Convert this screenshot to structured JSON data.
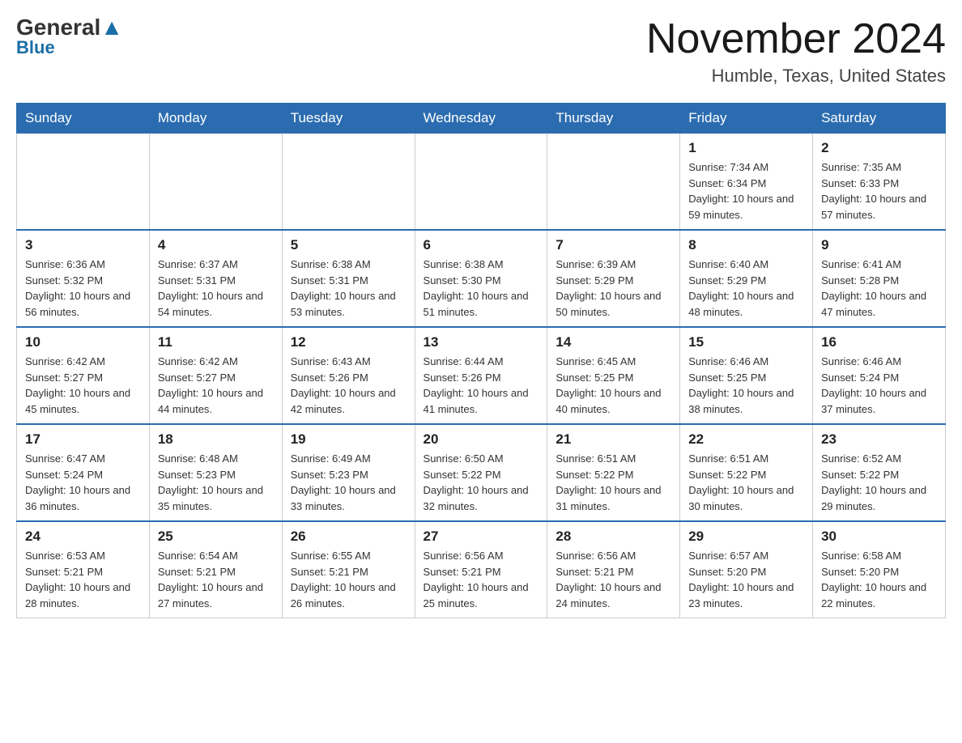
{
  "header": {
    "logo_general": "General",
    "logo_blue": "Blue",
    "month_title": "November 2024",
    "location": "Humble, Texas, United States"
  },
  "weekdays": [
    "Sunday",
    "Monday",
    "Tuesday",
    "Wednesday",
    "Thursday",
    "Friday",
    "Saturday"
  ],
  "weeks": [
    [
      {
        "day": "",
        "info": ""
      },
      {
        "day": "",
        "info": ""
      },
      {
        "day": "",
        "info": ""
      },
      {
        "day": "",
        "info": ""
      },
      {
        "day": "",
        "info": ""
      },
      {
        "day": "1",
        "info": "Sunrise: 7:34 AM\nSunset: 6:34 PM\nDaylight: 10 hours and 59 minutes."
      },
      {
        "day": "2",
        "info": "Sunrise: 7:35 AM\nSunset: 6:33 PM\nDaylight: 10 hours and 57 minutes."
      }
    ],
    [
      {
        "day": "3",
        "info": "Sunrise: 6:36 AM\nSunset: 5:32 PM\nDaylight: 10 hours and 56 minutes."
      },
      {
        "day": "4",
        "info": "Sunrise: 6:37 AM\nSunset: 5:31 PM\nDaylight: 10 hours and 54 minutes."
      },
      {
        "day": "5",
        "info": "Sunrise: 6:38 AM\nSunset: 5:31 PM\nDaylight: 10 hours and 53 minutes."
      },
      {
        "day": "6",
        "info": "Sunrise: 6:38 AM\nSunset: 5:30 PM\nDaylight: 10 hours and 51 minutes."
      },
      {
        "day": "7",
        "info": "Sunrise: 6:39 AM\nSunset: 5:29 PM\nDaylight: 10 hours and 50 minutes."
      },
      {
        "day": "8",
        "info": "Sunrise: 6:40 AM\nSunset: 5:29 PM\nDaylight: 10 hours and 48 minutes."
      },
      {
        "day": "9",
        "info": "Sunrise: 6:41 AM\nSunset: 5:28 PM\nDaylight: 10 hours and 47 minutes."
      }
    ],
    [
      {
        "day": "10",
        "info": "Sunrise: 6:42 AM\nSunset: 5:27 PM\nDaylight: 10 hours and 45 minutes."
      },
      {
        "day": "11",
        "info": "Sunrise: 6:42 AM\nSunset: 5:27 PM\nDaylight: 10 hours and 44 minutes."
      },
      {
        "day": "12",
        "info": "Sunrise: 6:43 AM\nSunset: 5:26 PM\nDaylight: 10 hours and 42 minutes."
      },
      {
        "day": "13",
        "info": "Sunrise: 6:44 AM\nSunset: 5:26 PM\nDaylight: 10 hours and 41 minutes."
      },
      {
        "day": "14",
        "info": "Sunrise: 6:45 AM\nSunset: 5:25 PM\nDaylight: 10 hours and 40 minutes."
      },
      {
        "day": "15",
        "info": "Sunrise: 6:46 AM\nSunset: 5:25 PM\nDaylight: 10 hours and 38 minutes."
      },
      {
        "day": "16",
        "info": "Sunrise: 6:46 AM\nSunset: 5:24 PM\nDaylight: 10 hours and 37 minutes."
      }
    ],
    [
      {
        "day": "17",
        "info": "Sunrise: 6:47 AM\nSunset: 5:24 PM\nDaylight: 10 hours and 36 minutes."
      },
      {
        "day": "18",
        "info": "Sunrise: 6:48 AM\nSunset: 5:23 PM\nDaylight: 10 hours and 35 minutes."
      },
      {
        "day": "19",
        "info": "Sunrise: 6:49 AM\nSunset: 5:23 PM\nDaylight: 10 hours and 33 minutes."
      },
      {
        "day": "20",
        "info": "Sunrise: 6:50 AM\nSunset: 5:22 PM\nDaylight: 10 hours and 32 minutes."
      },
      {
        "day": "21",
        "info": "Sunrise: 6:51 AM\nSunset: 5:22 PM\nDaylight: 10 hours and 31 minutes."
      },
      {
        "day": "22",
        "info": "Sunrise: 6:51 AM\nSunset: 5:22 PM\nDaylight: 10 hours and 30 minutes."
      },
      {
        "day": "23",
        "info": "Sunrise: 6:52 AM\nSunset: 5:22 PM\nDaylight: 10 hours and 29 minutes."
      }
    ],
    [
      {
        "day": "24",
        "info": "Sunrise: 6:53 AM\nSunset: 5:21 PM\nDaylight: 10 hours and 28 minutes."
      },
      {
        "day": "25",
        "info": "Sunrise: 6:54 AM\nSunset: 5:21 PM\nDaylight: 10 hours and 27 minutes."
      },
      {
        "day": "26",
        "info": "Sunrise: 6:55 AM\nSunset: 5:21 PM\nDaylight: 10 hours and 26 minutes."
      },
      {
        "day": "27",
        "info": "Sunrise: 6:56 AM\nSunset: 5:21 PM\nDaylight: 10 hours and 25 minutes."
      },
      {
        "day": "28",
        "info": "Sunrise: 6:56 AM\nSunset: 5:21 PM\nDaylight: 10 hours and 24 minutes."
      },
      {
        "day": "29",
        "info": "Sunrise: 6:57 AM\nSunset: 5:20 PM\nDaylight: 10 hours and 23 minutes."
      },
      {
        "day": "30",
        "info": "Sunrise: 6:58 AM\nSunset: 5:20 PM\nDaylight: 10 hours and 22 minutes."
      }
    ]
  ]
}
